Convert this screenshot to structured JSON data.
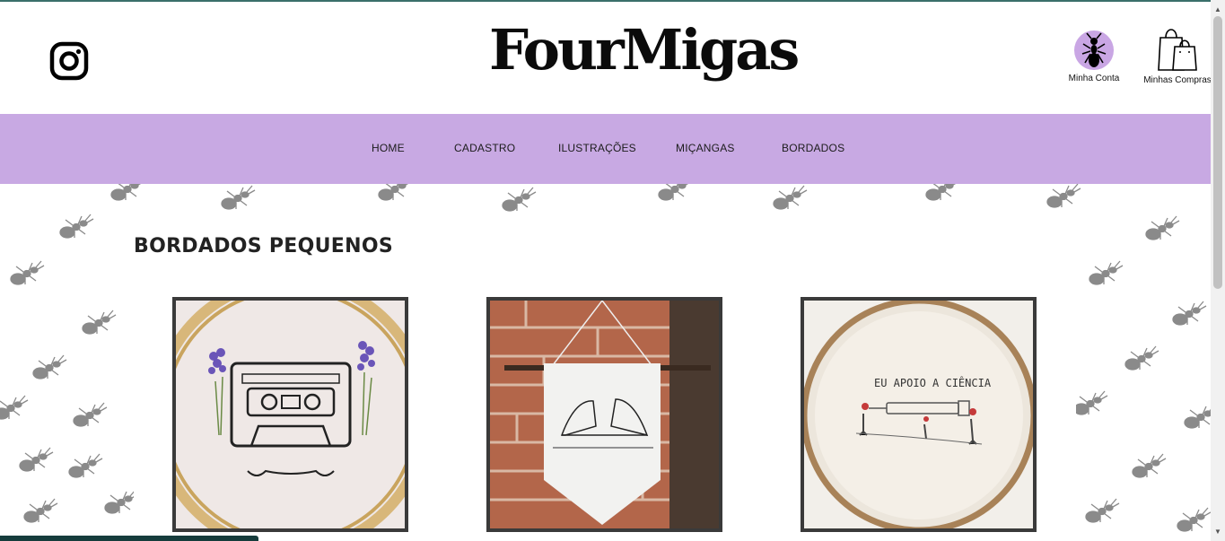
{
  "header": {
    "logo_text": "FourMigas",
    "instagram_icon": "instagram-icon",
    "account_label": "Minha Conta",
    "cart_label": "Minhas Compras"
  },
  "nav": {
    "items": [
      {
        "label": "HOME"
      },
      {
        "label": "CADASTRO"
      },
      {
        "label": "ILUSTRAÇÕES"
      },
      {
        "label": "MIÇANGAS"
      },
      {
        "label": "BORDADOS"
      }
    ]
  },
  "main": {
    "section_title": "BORDADOS PEQUENOS",
    "cards": [
      {
        "subject": "cassette-embroidery"
      },
      {
        "subject": "sneakers-banner"
      },
      {
        "subject": "science-embroidery",
        "caption": "EU APOIO A CIÊNCIA"
      }
    ]
  },
  "colors": {
    "nav_bg": "#c8a9e3",
    "avatar_bg": "#c9a6e4",
    "card_border": "#3a3a3a",
    "text": "#222222"
  }
}
